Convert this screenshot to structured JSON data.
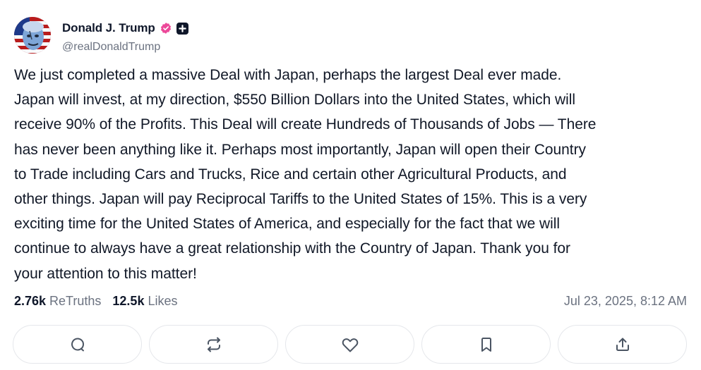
{
  "author": {
    "display_name": "Donald J. Trump",
    "handle": "@realDonaldTrump",
    "avatar_icon": "avatar-portrait-flag",
    "verified_icon": "verified-badge-icon",
    "plus_icon": "plus-badge-icon",
    "colors": {
      "verified": "#ec4899"
    }
  },
  "post": {
    "text": "We just completed a massive Deal with Japan, perhaps the largest Deal ever made.\nJapan will invest, at my direction, $550 Billion Dollars into the United States, which will\nreceive 90% of the Profits. This Deal will create Hundreds of Thousands of Jobs — There\nhas never been anything like it. Perhaps most importantly, Japan will open their Country\nto Trade including Cars and Trucks, Rice and certain other Agricultural Products, and\nother things. Japan will pay Reciprocal Tariffs to the United States of 15%. This is a very\nexciting time for the United States of America, and especially for the fact that we will\ncontinue to always have a great relationship with the Country of Japan. Thank you for\nyour attention to this matter!",
    "retruths_count": "2.76k",
    "retruths_label": "ReTruths",
    "likes_count": "12.5k",
    "likes_label": "Likes",
    "timestamp": "Jul 23, 2025, 8:12 AM"
  },
  "actions": [
    {
      "icon": "reply-icon"
    },
    {
      "icon": "retruth-icon"
    },
    {
      "icon": "like-icon"
    },
    {
      "icon": "bookmark-icon"
    },
    {
      "icon": "share-icon"
    }
  ]
}
